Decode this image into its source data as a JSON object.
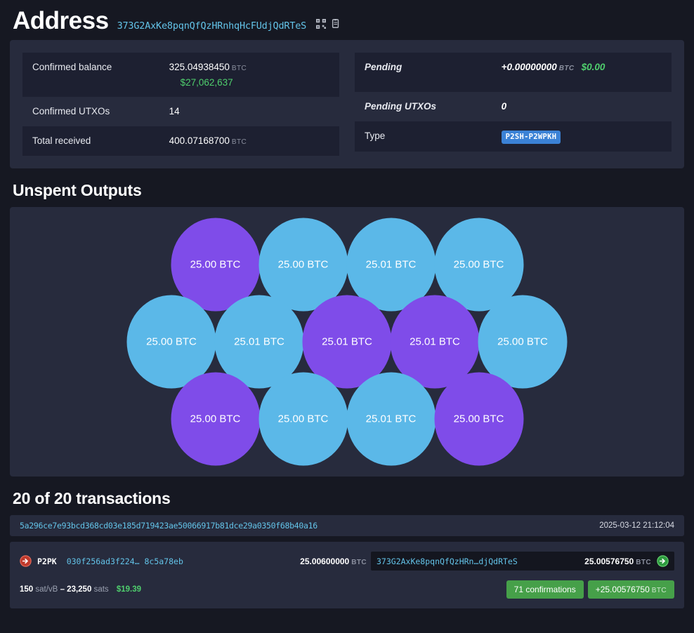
{
  "header": {
    "title": "Address",
    "address": "373G2AxKe8pqnQfQzHRnhqHcFUdjQdRTeS",
    "qr_icon": "qr-code-icon",
    "copy_icon": "clipboard-copy-icon"
  },
  "summary": {
    "left": [
      {
        "label": "Confirmed balance",
        "value": "325.04938450",
        "unit": "BTC",
        "fiat": "$27,062,637",
        "italic": false,
        "alt": true,
        "tall": true
      },
      {
        "label": "Confirmed UTXOs",
        "value": "14",
        "unit": "",
        "fiat": "",
        "italic": false,
        "alt": false,
        "tall": false
      },
      {
        "label": "Total received",
        "value": "400.07168700",
        "unit": "BTC",
        "fiat": "",
        "italic": false,
        "alt": true,
        "tall": false
      }
    ],
    "right": [
      {
        "label": "Pending",
        "value": "+0.00000000",
        "unit": "BTC",
        "fiat": "$0.00",
        "italic": true,
        "alt": true,
        "tall": true
      },
      {
        "label": "Pending UTXOs",
        "value": "0",
        "unit": "",
        "fiat": "",
        "italic": true,
        "alt": false,
        "tall": false
      },
      {
        "label": "Type",
        "badge": "P2SH-P2WPKH",
        "value": "",
        "unit": "",
        "fiat": "",
        "italic": false,
        "alt": true,
        "tall": false
      }
    ]
  },
  "unspent_outputs": {
    "title": "Unspent Outputs",
    "rows": [
      [
        {
          "label": "25.00 BTC",
          "color": "purple"
        },
        {
          "label": "25.00 BTC",
          "color": "blue"
        },
        {
          "label": "25.01 BTC",
          "color": "blue"
        },
        {
          "label": "25.00 BTC",
          "color": "blue"
        }
      ],
      [
        {
          "label": "25.00 BTC",
          "color": "blue"
        },
        {
          "label": "25.01 BTC",
          "color": "blue"
        },
        {
          "label": "25.01 BTC",
          "color": "purple"
        },
        {
          "label": "25.01 BTC",
          "color": "purple"
        },
        {
          "label": "25.00 BTC",
          "color": "blue"
        }
      ],
      [
        {
          "label": "25.00 BTC",
          "color": "purple"
        },
        {
          "label": "25.00 BTC",
          "color": "blue"
        },
        {
          "label": "25.01 BTC",
          "color": "blue"
        },
        {
          "label": "25.00 BTC",
          "color": "purple"
        }
      ]
    ],
    "colors": {
      "purple": "#7f4ce9",
      "blue": "#5bb8e8"
    }
  },
  "transactions": {
    "title": "20 of 20 transactions",
    "items": [
      {
        "txid": "5a296ce7e93bcd368cd03e185d719423ae50066917b81dce29a0350f68b40a16",
        "time": "2025-03-12 21:12:04",
        "input": {
          "icon": "arrow-right-red-icon",
          "type": "P2PK",
          "address": "030f256ad3f224… 8c5a78eb",
          "amount": "25.00600000",
          "unit": "BTC"
        },
        "output": {
          "address": "373G2AxKe8pqnQfQzHRn…djQdRTeS",
          "amount": "25.00576750",
          "unit": "BTC",
          "icon": "arrow-right-green-icon"
        },
        "fee": {
          "rate": "150",
          "rate_unit": "sat/vB",
          "dash": "–",
          "sats": "23,250",
          "sats_unit": "sats",
          "fiat": "$19.39"
        },
        "confirmations_badge": "71 confirmations",
        "amount_badge": "+25.00576750",
        "amount_badge_unit": "BTC"
      }
    ]
  }
}
